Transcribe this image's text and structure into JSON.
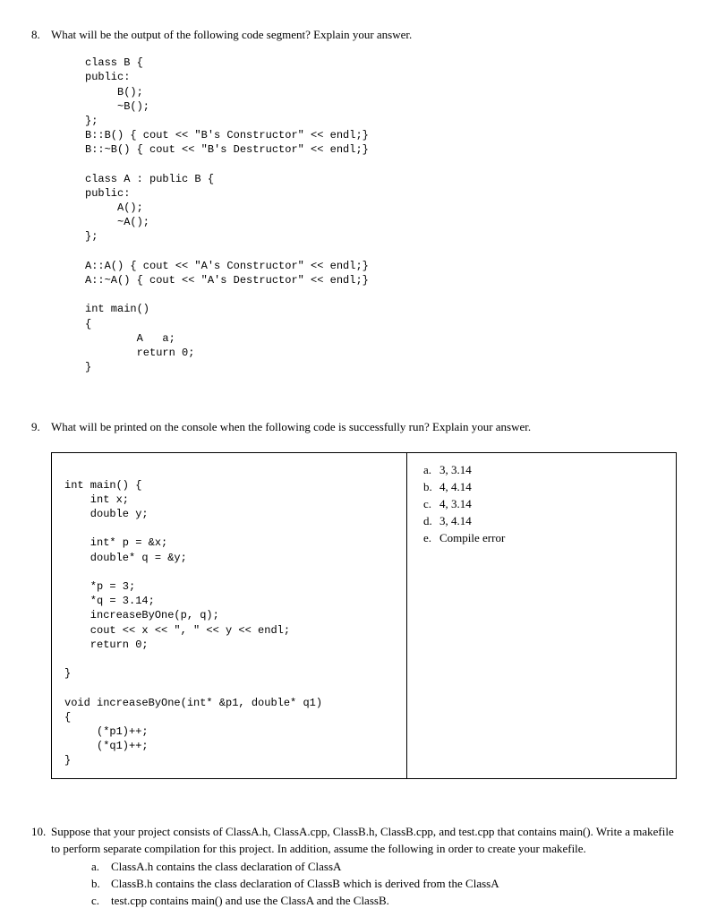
{
  "q8": {
    "number": "8.",
    "text": "What will be the output of the following code segment? Explain your answer.",
    "code": "class B {\npublic:\n     B();\n     ~B();\n};\nB::B() { cout << \"B's Constructor\" << endl;}\nB::~B() { cout << \"B's Destructor\" << endl;}\n\nclass A : public B {\npublic:\n     A();\n     ~A();\n};\n\nA::A() { cout << \"A's Constructor\" << endl;}\nA::~A() { cout << \"A's Destructor\" << endl;}\n\nint main()\n{\n        A   a;\n        return 0;\n}"
  },
  "q9": {
    "number": "9.",
    "text": "What will be printed on the console when the following code is successfully run? Explain your answer.",
    "code": "\nint main() {\n    int x;\n    double y;\n\n    int* p = &x;\n    double* q = &y;\n\n    *p = 3;\n    *q = 3.14;\n    increaseByOne(p, q);\n    cout << x << \", \" << y << endl;\n    return 0;\n\n}\n\nvoid increaseByOne(int* &p1, double* q1)\n{\n     (*p1)++;\n     (*q1)++;\n}",
    "options": {
      "a": {
        "letter": "a.",
        "text": "3, 3.14"
      },
      "b": {
        "letter": "b.",
        "text": "4, 4.14"
      },
      "c": {
        "letter": "c.",
        "text": "4, 3.14"
      },
      "d": {
        "letter": "d.",
        "text": "3, 4.14"
      },
      "e": {
        "letter": "e.",
        "text": "Compile error"
      }
    }
  },
  "q10": {
    "number": "10.",
    "text": "Suppose that your project consists of ClassA.h, ClassA.cpp, ClassB.h, ClassB.cpp, and test.cpp that contains main(). Write a makefile to perform separate compilation for this project. In addition, assume the following in order to create your makefile.",
    "subitems": {
      "a": {
        "letter": "a.",
        "text": "ClassA.h contains the class declaration of ClassA"
      },
      "b": {
        "letter": "b.",
        "text": "ClassB.h contains the class declaration of ClassB which is derived from the ClassA"
      },
      "c": {
        "letter": "c.",
        "text": "test.cpp contains main() and use the ClassA and the ClassB."
      }
    }
  }
}
